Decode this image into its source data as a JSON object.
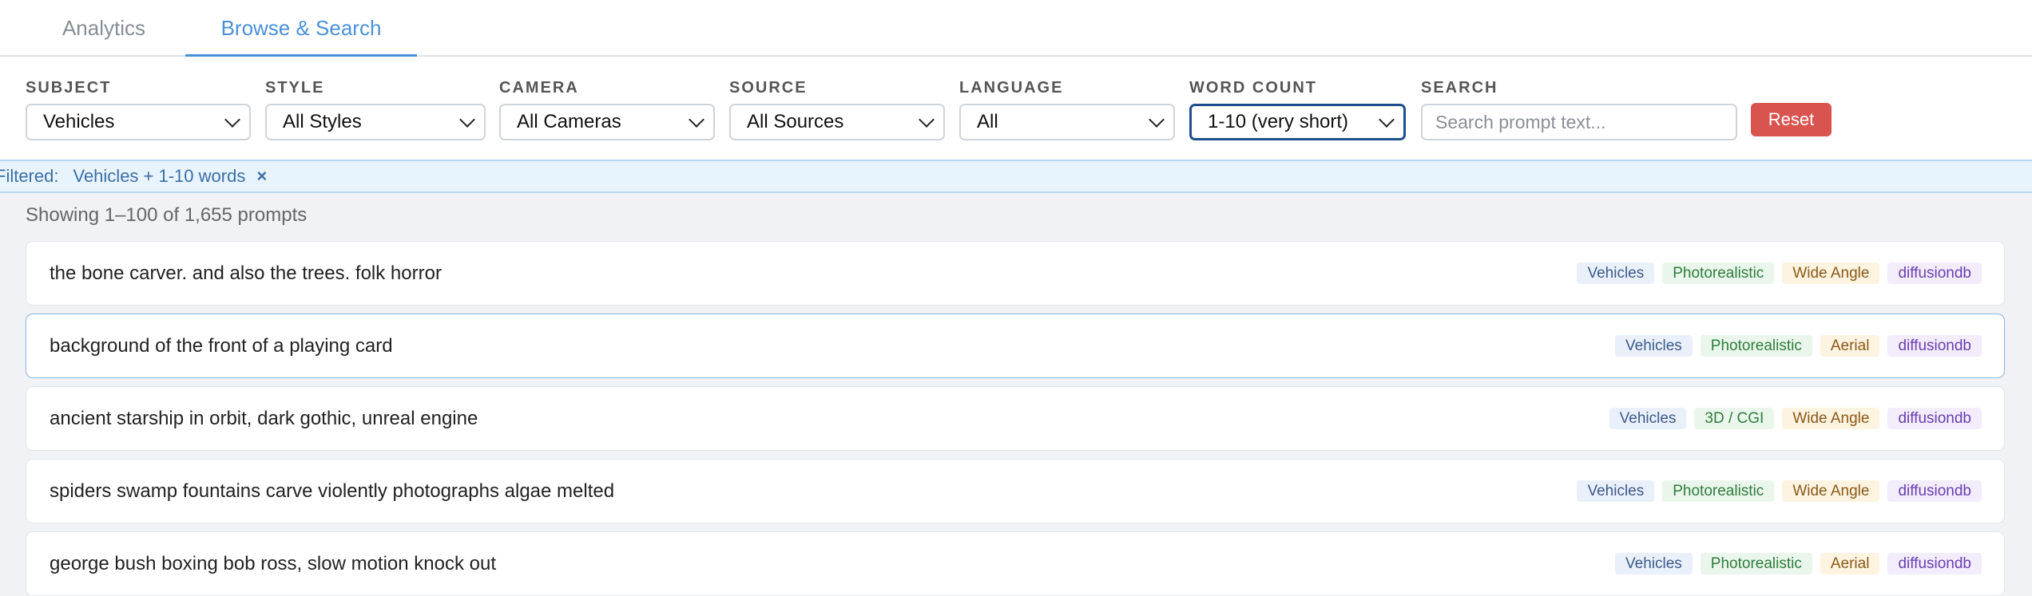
{
  "tabs": [
    {
      "label": "Analytics",
      "active": false
    },
    {
      "label": "Browse & Search",
      "active": true
    }
  ],
  "filters": {
    "subject": {
      "label": "SUBJECT",
      "value": "Vehicles"
    },
    "style": {
      "label": "STYLE",
      "value": "All Styles"
    },
    "camera": {
      "label": "CAMERA",
      "value": "All Cameras"
    },
    "source": {
      "label": "SOURCE",
      "value": "All Sources"
    },
    "language": {
      "label": "LANGUAGE",
      "value": "All"
    },
    "word_count": {
      "label": "WORD COUNT",
      "value": "1-10 (very short)"
    },
    "search": {
      "label": "SEARCH",
      "value": "",
      "placeholder": "Search prompt text..."
    },
    "reset_label": "Reset"
  },
  "active_filter": {
    "label": "Filtered:",
    "value": "Vehicles + 1-10 words",
    "clear": "×"
  },
  "results": {
    "count_text": "Showing 1–100 of 1,655 prompts",
    "items": [
      {
        "text": "the bone carver. and also the trees. folk horror",
        "subject": "Vehicles",
        "style": "Photorealistic",
        "camera": "Wide Angle",
        "source": "diffusiondb"
      },
      {
        "text": "background of the front of a playing card",
        "subject": "Vehicles",
        "style": "Photorealistic",
        "camera": "Aerial",
        "source": "diffusiondb"
      },
      {
        "text": "ancient starship in orbit, dark gothic, unreal engine",
        "subject": "Vehicles",
        "style": "3D / CGI",
        "camera": "Wide Angle",
        "source": "diffusiondb"
      },
      {
        "text": "spiders swamp fountains carve violently photographs algae melted",
        "subject": "Vehicles",
        "style": "Photorealistic",
        "camera": "Wide Angle",
        "source": "diffusiondb"
      },
      {
        "text": "george bush boxing bob ross, slow motion knock out",
        "subject": "Vehicles",
        "style": "Photorealistic",
        "camera": "Aerial",
        "source": "diffusiondb"
      }
    ]
  },
  "colors": {
    "accent": "#4a90d9",
    "reset": "#d9534f",
    "active_select_border": "#1f4e8c"
  },
  "icons": {
    "select_arrow": "chevron-down-icon",
    "clear_filter": "close-icon"
  }
}
